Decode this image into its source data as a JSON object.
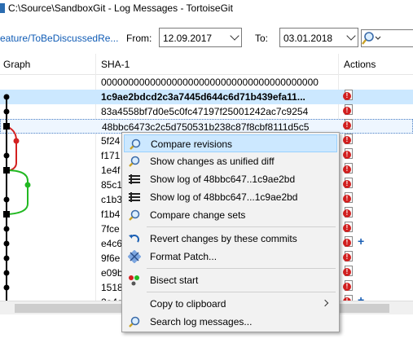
{
  "window": {
    "title": "C:\\Source\\SandboxGit - Log Messages - TortoiseGit"
  },
  "toolbar": {
    "branch": "eature/ToBeDiscussedRe...",
    "from_label": "From:",
    "from_value": "12.09.2017",
    "to_label": "To:",
    "to_value": "03.01.2018"
  },
  "columns": {
    "graph": "Graph",
    "sha": "SHA-1",
    "actions": "Actions"
  },
  "rows": [
    {
      "sha": "0000000000000000000000000000000000000000"
    },
    {
      "sha": "1c9ae2bdcd2c3a7445d644c6d71b439efa11..."
    },
    {
      "sha": "83a4558bf7d0e5c0fc47197f25001242ac7c9254"
    },
    {
      "sha": "48bbc6473c2c5d750531b238c87f8cbf8111d5c5"
    },
    {
      "sha": "5f24"
    },
    {
      "sha": "f171"
    },
    {
      "sha": "1e4f"
    },
    {
      "sha": "85c1"
    },
    {
      "sha": "c1b3"
    },
    {
      "sha": "f1b4"
    },
    {
      "sha": "7fce"
    },
    {
      "sha": "e4c6"
    },
    {
      "sha": "9f6e"
    },
    {
      "sha": "e09b"
    },
    {
      "sha": "1518"
    },
    {
      "sha": "2a4a"
    }
  ],
  "context_menu": {
    "items": [
      {
        "label": "Compare revisions",
        "icon": "magnifier-icon"
      },
      {
        "label": "Show changes as unified diff",
        "icon": "magnifier-icon"
      },
      {
        "label": "Show log of 48bbc647..1c9ae2bd",
        "icon": "log-icon"
      },
      {
        "label": "Show log of 48bbc647...1c9ae2bd",
        "icon": "log-icon"
      },
      {
        "label": "Compare change sets",
        "icon": "magnifier-icon"
      },
      {
        "label": "Revert changes by these commits",
        "icon": "revert-icon"
      },
      {
        "label": "Format Patch...",
        "icon": "patch-icon"
      },
      {
        "label": "Bisect start",
        "icon": "bisect-icon"
      },
      {
        "label": "Copy to clipboard",
        "icon": ""
      },
      {
        "label": "Search log messages...",
        "icon": "search-icon"
      }
    ]
  },
  "colors": {
    "accent": "#cce8ff",
    "link": "#0f5bb5",
    "branch_red": "#d32020",
    "branch_green": "#22b822"
  }
}
